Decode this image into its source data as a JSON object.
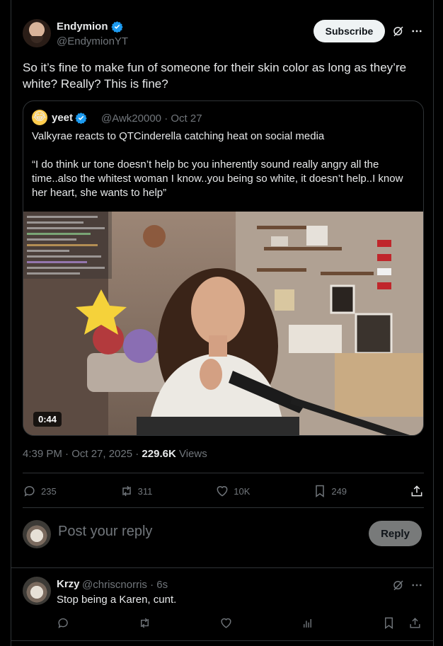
{
  "author": {
    "name": "Endymion",
    "handle": "@EndymionYT",
    "verified_icon": "verified-badge-icon",
    "accent": "#1d9bf0"
  },
  "header": {
    "subscribe_label": "Subscribe",
    "grok_icon": "grok-icon",
    "more_icon": "more-icon"
  },
  "tweet": {
    "text": "So it’s fine to make fun of someone for their skin color as long as they’re white? Really? This is fine?"
  },
  "quote": {
    "avatar_emoji": "😂",
    "name": "yeet",
    "handle": "@Awk20000",
    "date": "· Oct 27",
    "line1": "Valkyrae reacts to QTCinderella catching heat on social media",
    "line2": "“I do think ur tone doesn’t help bc you inherently sound really angry all the time..also the whitest woman I know..you being so white, it doesn’t help..I know her heart, she wants to help”",
    "video_duration": "0:44"
  },
  "meta": {
    "time": "4:39 PM · Oct 27, 2025 · ",
    "views_count": "229.6K",
    "views_label": " Views"
  },
  "actions": {
    "replies": "235",
    "reposts": "311",
    "likes": "10K",
    "bookmarks": "249"
  },
  "reply_box": {
    "placeholder": "Post your reply",
    "button": "Reply"
  },
  "reply": {
    "name": "Krzy",
    "handle": "@chriscnorris",
    "time": "· 6s",
    "text": "Stop being a Karen, cunt."
  }
}
